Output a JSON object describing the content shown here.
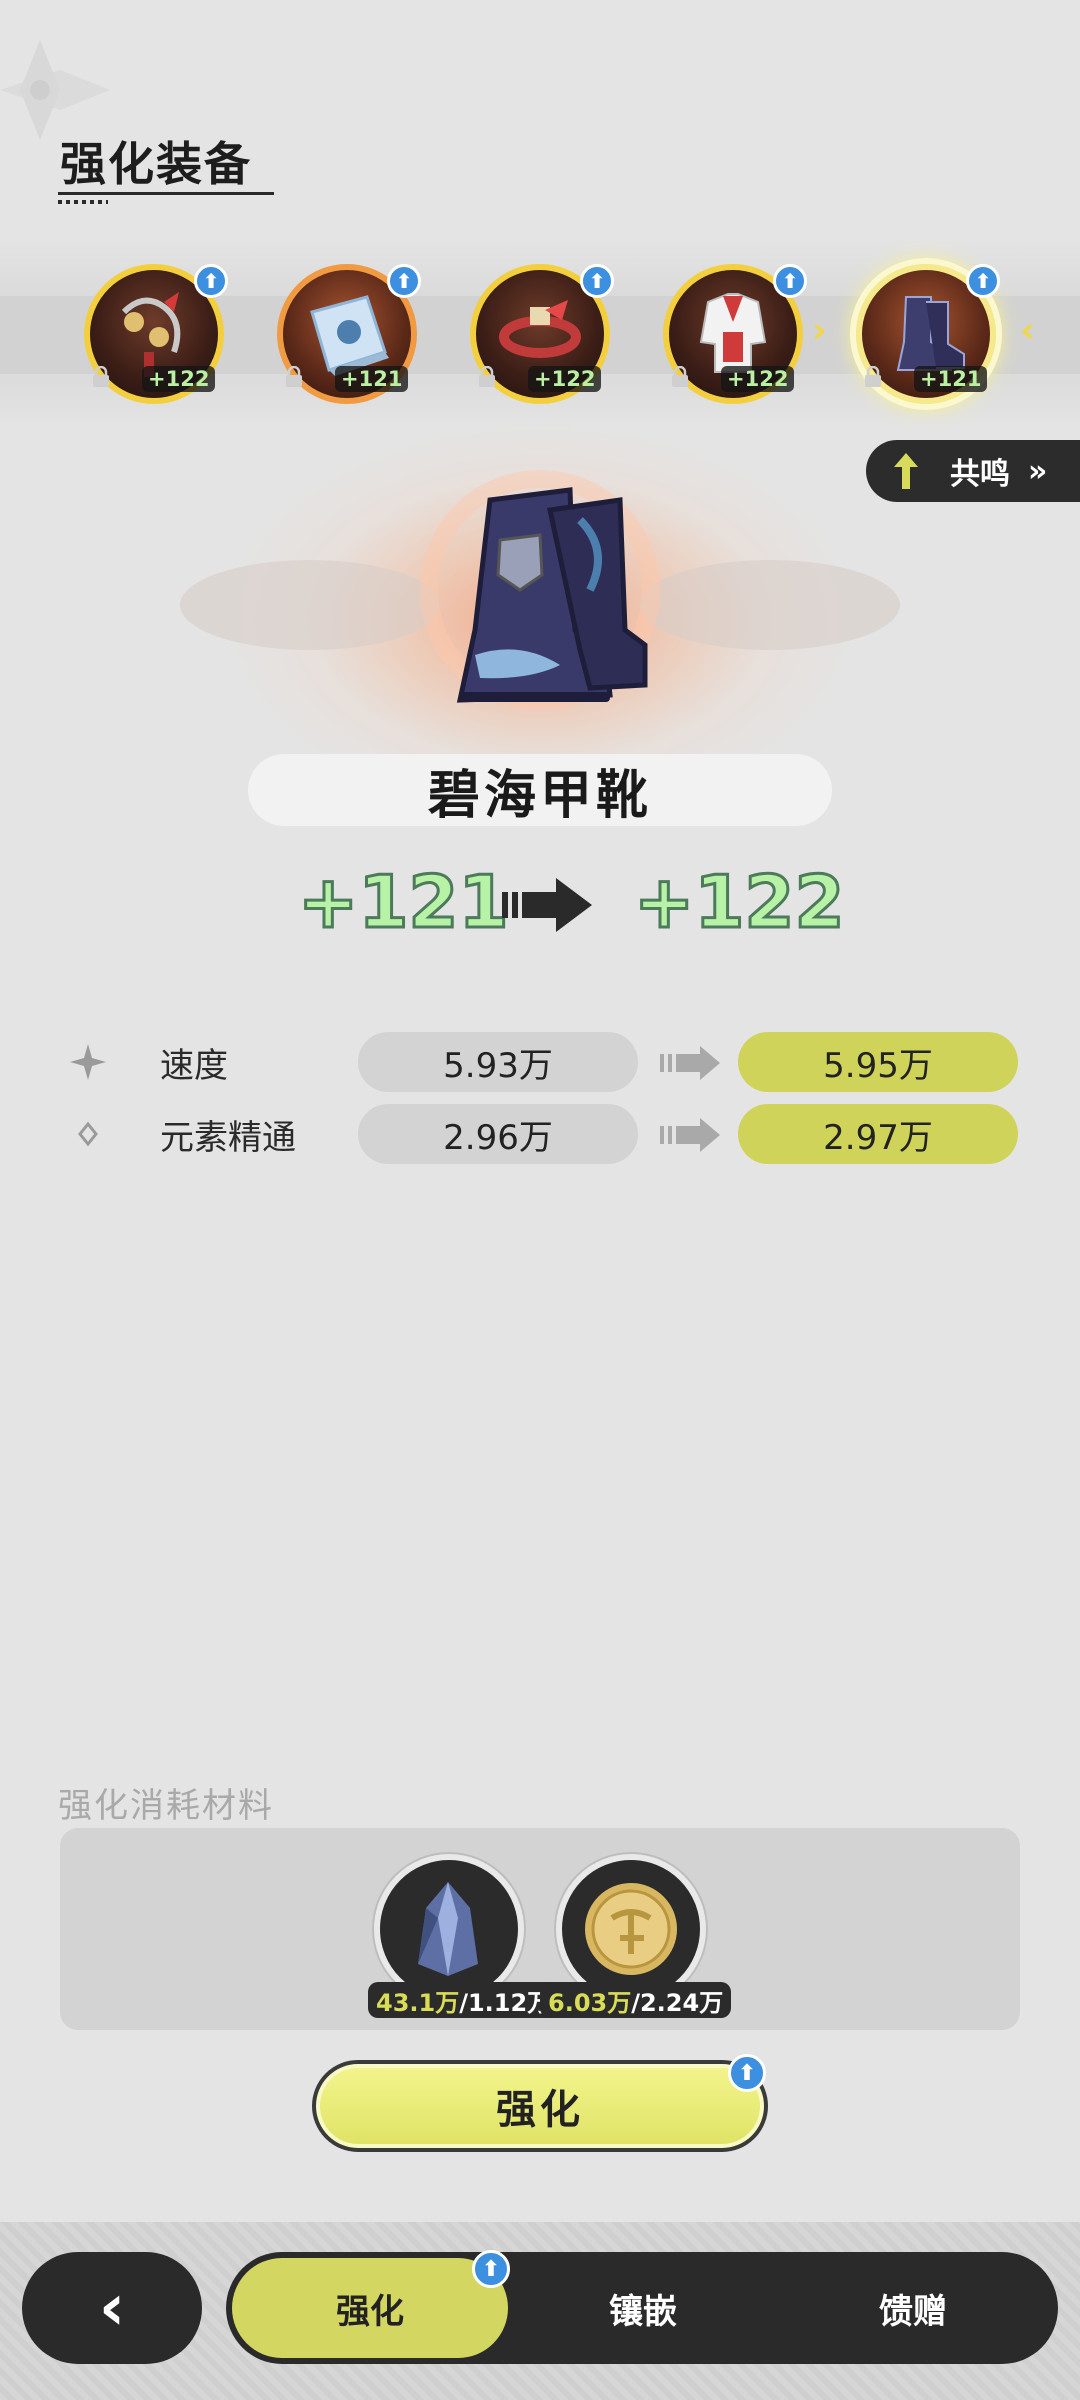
{
  "header": {
    "title": "强化装备"
  },
  "equipment": [
    {
      "name": "feather-charm",
      "level": "+122",
      "frame": "gold",
      "selected": false
    },
    {
      "name": "book",
      "level": "+121",
      "frame": "orange",
      "selected": false
    },
    {
      "name": "belt",
      "level": "+122",
      "frame": "gold",
      "selected": false
    },
    {
      "name": "armor",
      "level": "+122",
      "frame": "gold",
      "selected": false
    },
    {
      "name": "boots",
      "level": "+121",
      "frame": "orange",
      "selected": true
    }
  ],
  "resonance": {
    "label": "共鸣",
    "arrow": "»"
  },
  "item": {
    "name": "碧海甲靴",
    "level_from": "+121",
    "level_to": "+122"
  },
  "stats": [
    {
      "name": "速度",
      "icon": "sparkle-icon",
      "old": "5.93万",
      "new": "5.95万"
    },
    {
      "name": "元素精通",
      "icon": "diamond-icon",
      "old": "2.96万",
      "new": "2.97万"
    }
  ],
  "materials": {
    "title": "强化消耗材料",
    "items": [
      {
        "icon": "crystal-icon",
        "have": "43.1万",
        "need": "/1.12万"
      },
      {
        "icon": "coin-icon",
        "have": "6.03万",
        "need": "/2.24万"
      }
    ]
  },
  "enhance_button": {
    "label": "强化"
  },
  "bottom_nav": {
    "back": "‹",
    "tabs": [
      {
        "label": "强化",
        "active": true
      },
      {
        "label": "镶嵌",
        "active": false
      },
      {
        "label": "馈赠",
        "active": false
      }
    ]
  },
  "colors": {
    "accent_yellow": "#d3d660",
    "level_green": "#b7f2a6",
    "badge_blue": "#3d8fe0",
    "dark": "#2a2a2a"
  }
}
